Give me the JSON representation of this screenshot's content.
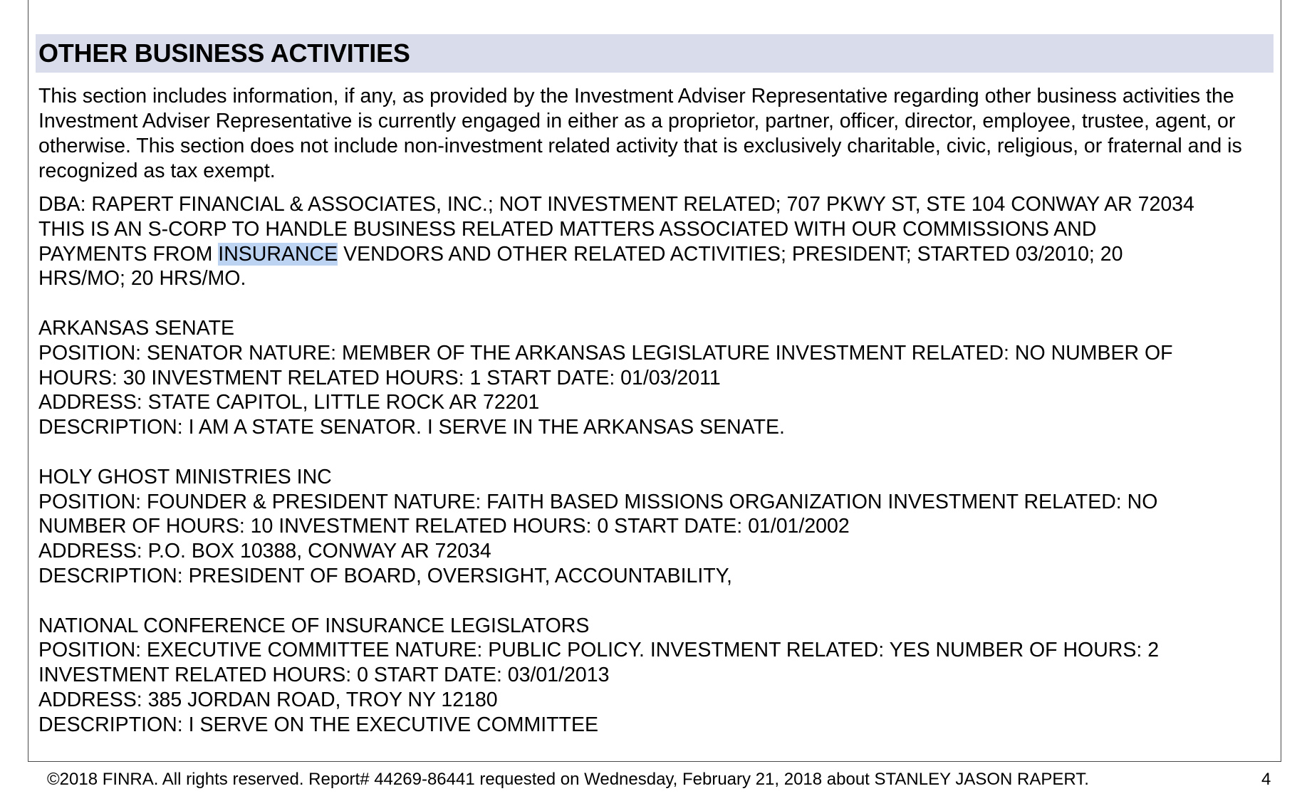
{
  "section": {
    "title": "OTHER BUSINESS ACTIVITIES",
    "intro": "This section includes information, if any, as provided by the Investment Adviser Representative regarding other business activities the Investment Adviser Representative is currently engaged in either as a proprietor, partner, officer, director, employee, trustee, agent, or otherwise. This section does not include non-investment related activity that is exclusively charitable, civic, religious, or fraternal and is recognized as tax exempt."
  },
  "dba": {
    "line1": "DBA: RAPERT FINANCIAL & ASSOCIATES, INC.; NOT INVESTMENT RELATED; 707 PKWY ST, STE 104 CONWAY AR 72034",
    "line2": "THIS IS AN S-CORP TO HANDLE BUSINESS RELATED MATTERS ASSOCIATED WITH OUR COMMISSIONS AND",
    "line3_pre": "PAYMENTS FROM ",
    "line3_highlight": "INSURANCE",
    "line3_post": " VENDORS AND OTHER RELATED ACTIVITIES; PRESIDENT; STARTED 03/2010; 20",
    "line4": "HRS/MO; 20 HRS/MO."
  },
  "activities": [
    {
      "name": "ARKANSAS SENATE",
      "line1": "POSITION: SENATOR NATURE: MEMBER OF THE ARKANSAS LEGISLATURE INVESTMENT RELATED: NO NUMBER OF",
      "line2": "HOURS: 30 INVESTMENT RELATED HOURS: 1 START DATE: 01/03/2011",
      "address": "ADDRESS: STATE CAPITOL, LITTLE ROCK AR 72201",
      "description": "DESCRIPTION: I AM A STATE SENATOR. I SERVE IN THE ARKANSAS SENATE."
    },
    {
      "name": "HOLY GHOST MINISTRIES INC",
      "line1": "POSITION: FOUNDER & PRESIDENT NATURE: FAITH BASED MISSIONS ORGANIZATION INVESTMENT RELATED: NO",
      "line2": "NUMBER OF HOURS: 10 INVESTMENT RELATED HOURS: 0 START DATE: 01/01/2002",
      "address": "ADDRESS: P.O. BOX 10388, CONWAY AR 72034",
      "description": "DESCRIPTION: PRESIDENT OF BOARD, OVERSIGHT, ACCOUNTABILITY,"
    },
    {
      "name": "NATIONAL CONFERENCE OF INSURANCE LEGISLATORS",
      "line1": "POSITION: EXECUTIVE COMMITTEE NATURE: PUBLIC POLICY. INVESTMENT RELATED: YES NUMBER OF HOURS: 2",
      "line2": "INVESTMENT RELATED HOURS: 0 START DATE: 03/01/2013",
      "address": "ADDRESS: 385 JORDAN ROAD, TROY NY 12180",
      "description": "DESCRIPTION: I SERVE ON THE EXECUTIVE COMMITTEE"
    }
  ],
  "footer": {
    "text": "©2018 FINRA. All rights reserved. Report# 44269-86441 requested on Wednesday, February 21, 2018 about STANLEY JASON RAPERT.",
    "page": "4"
  },
  "colors": {
    "header_band": "#d9dcea",
    "search_highlight": "#bcd3f2",
    "frame_border": "#4a4a4a"
  }
}
